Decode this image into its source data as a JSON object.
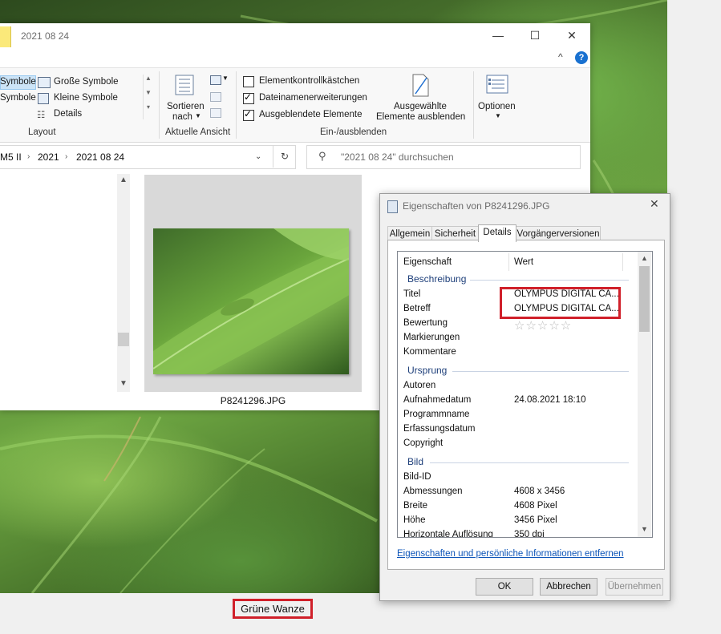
{
  "explorer": {
    "title": "2021 08 24",
    "window_buttons": {
      "minimize": "—",
      "maximize": "☐",
      "close": "✕"
    },
    "help": "?",
    "ribbon": {
      "layout_items": [
        "Symbole",
        "Große Symbole",
        "Symbole",
        "Kleine Symbole",
        "Details"
      ],
      "layout_label": "Layout",
      "sort_label_1": "Sortieren",
      "sort_label_2": "nach",
      "current_view_label": "Aktuelle Ansicht",
      "checkbox_1": "Elementkontrollkästchen",
      "checkbox_2": "Dateinamenerweiterungen",
      "checkbox_3": "Ausgeblendete Elemente",
      "hide_selected_1": "Ausgewählte",
      "hide_selected_2": "Elemente ausblenden",
      "show_hide_label": "Ein-/ausblenden",
      "options_label": "Optionen"
    },
    "breadcrumb": [
      "M5 II",
      "2021",
      "2021 08 24"
    ],
    "search_placeholder": "\"2021 08 24\" durchsuchen",
    "file": {
      "name": "P8241296.JPG"
    }
  },
  "properties": {
    "title": "Eigenschaften von P8241296.JPG",
    "tabs": [
      "Allgemein",
      "Sicherheit",
      "Details",
      "Vorgängerversionen"
    ],
    "active_tab": "Details",
    "columns": {
      "property": "Eigenschaft",
      "value": "Wert"
    },
    "groups": {
      "beschreibung": "Beschreibung",
      "ursprung": "Ursprung",
      "bild": "Bild"
    },
    "rows": {
      "titel": {
        "key": "Titel",
        "value": "OLYMPUS DIGITAL CA..."
      },
      "betreff": {
        "key": "Betreff",
        "value": "OLYMPUS DIGITAL CA..."
      },
      "bewertung": {
        "key": "Bewertung",
        "value": "☆☆☆☆☆"
      },
      "markierungen": {
        "key": "Markierungen",
        "value": ""
      },
      "kommentare": {
        "key": "Kommentare",
        "value": ""
      },
      "autoren": {
        "key": "Autoren",
        "value": ""
      },
      "aufnahmedatum": {
        "key": "Aufnahmedatum",
        "value": "24.08.2021 18:10"
      },
      "programmname": {
        "key": "Programmname",
        "value": ""
      },
      "erfassungsdatum": {
        "key": "Erfassungsdatum",
        "value": ""
      },
      "copyright": {
        "key": "Copyright",
        "value": ""
      },
      "bild_id": {
        "key": "Bild-ID",
        "value": ""
      },
      "abmessungen": {
        "key": "Abmessungen",
        "value": "4608 x 3456"
      },
      "breite": {
        "key": "Breite",
        "value": "4608 Pixel"
      },
      "hoehe": {
        "key": "Höhe",
        "value": "3456 Pixel"
      },
      "horizontale": {
        "key": "Horizontale Auflösung",
        "value": "350 dpi"
      }
    },
    "link": "Eigenschaften und persönliche Informationen entfernen",
    "buttons": {
      "ok": "OK",
      "cancel": "Abbrechen",
      "apply": "Übernehmen"
    }
  },
  "caption": "Grüne Wanze",
  "colors": {
    "highlight_box": "#d0202a",
    "link": "#0d55b8",
    "group_heading": "#1e3f7a"
  }
}
